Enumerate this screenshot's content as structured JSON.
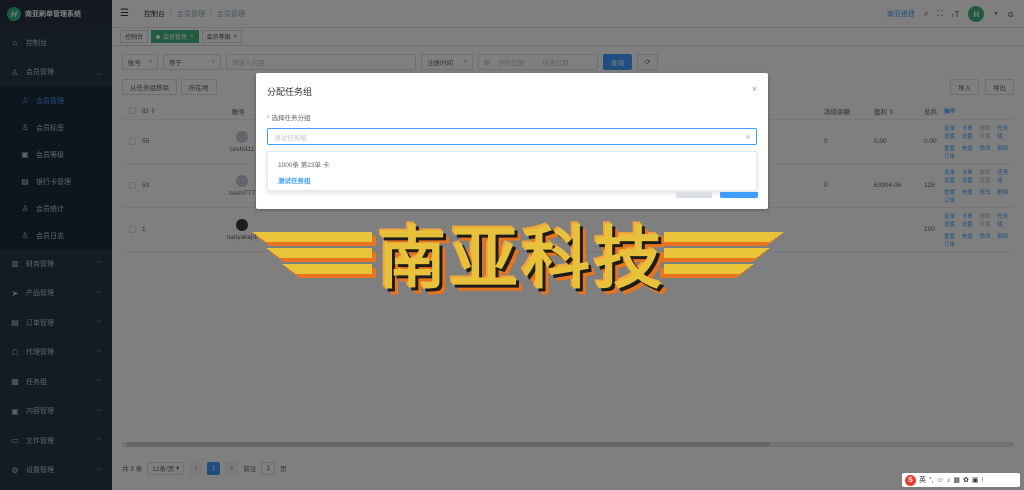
{
  "app": {
    "title": "南亚刷单管理系统",
    "logo_letter": "H"
  },
  "sidebar": {
    "items": [
      {
        "label": "控制台",
        "icon": "home-icon"
      },
      {
        "label": "会员管理",
        "icon": "user-icon"
      }
    ],
    "member_sub": [
      {
        "label": "会员管理",
        "active": true
      },
      {
        "label": "会员标签"
      },
      {
        "label": "会员等级"
      },
      {
        "label": "银行卡管理"
      },
      {
        "label": "会员统计"
      },
      {
        "label": "会员日志"
      }
    ],
    "rest": [
      {
        "label": "财务管理"
      },
      {
        "label": "产品管理"
      },
      {
        "label": "订单管理"
      },
      {
        "label": "代理管理"
      },
      {
        "label": "任务组"
      },
      {
        "label": "内容管理"
      },
      {
        "label": "文件管理"
      },
      {
        "label": "设置管理"
      }
    ]
  },
  "header": {
    "breadcrumb": [
      "控制台",
      "会员管理",
      "会员管理"
    ],
    "link": "南亚搭建"
  },
  "tags": [
    {
      "label": "控制台"
    },
    {
      "label": "会员管理",
      "active": true
    },
    {
      "label": "会员等级"
    }
  ],
  "filter": {
    "field": "账号",
    "operator": "等于",
    "keyword_placeholder": "请输入内容",
    "date_type": "注册时间",
    "start_placeholder": "开始日期",
    "range_sep": "-",
    "end_placeholder": "结束日期",
    "search": "查询"
  },
  "toolbar": {
    "left": [
      "从任务组移除",
      "所在地"
    ],
    "right": [
      "导入",
      "导出"
    ]
  },
  "table": {
    "columns": [
      "ID",
      "账号",
      "冻结余额",
      "盈利",
      "总共",
      "操作"
    ],
    "rows": [
      {
        "id": "55",
        "account": "ceshi111",
        "bal": "0",
        "profit": "0.00",
        "total": "0.00"
      },
      {
        "id": "53",
        "account": "ceshi777",
        "bal": "0",
        "profit": "63904.06",
        "total": "128"
      },
      {
        "id": "1",
        "account": "nanyakeji1",
        "bal": "",
        "profit": "",
        "total": "100"
      }
    ],
    "ops": [
      "连单设置",
      "卡单设置",
      "撤销设置",
      "任务组",
      "重置订单",
      "充值",
      "修改",
      "删除"
    ]
  },
  "pager": {
    "total": "共 3 条",
    "size": "12条/页",
    "page": "1",
    "goto": "前往",
    "goto_val": "1",
    "unit": "页"
  },
  "dialog": {
    "title": "分配任务组",
    "label": "选择任务分组",
    "placeholder": "测试任务组",
    "options": [
      "1000条 第23单 卡",
      "测试任务组"
    ]
  },
  "watermark": {
    "text": "南亚科技"
  },
  "ime": {
    "lang": "英"
  }
}
